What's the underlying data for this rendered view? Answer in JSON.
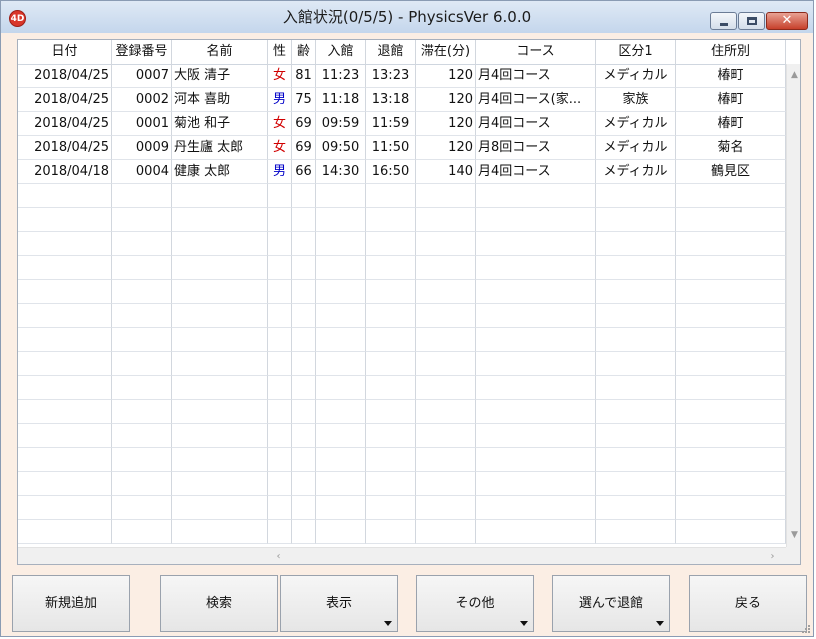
{
  "window": {
    "title": "入館状況(0/5/5) - PhysicsVer 6.0.0",
    "app_icon_text": "4D",
    "close_glyph": "✕"
  },
  "table": {
    "columns": [
      "日付",
      "登録番号",
      "名前",
      "性",
      "齢",
      "入館",
      "退館",
      "滞在(分)",
      "コース",
      "区分1",
      "住所別"
    ],
    "rows": [
      {
        "date": "2018/04/25",
        "id": "0007",
        "name": "大阪  清子",
        "sex": "女",
        "age": "81",
        "in": "11:23",
        "out": "13:23",
        "stay": "120",
        "course": "月4回コース",
        "cat": "メディカル",
        "area": "椿町"
      },
      {
        "date": "2018/04/25",
        "id": "0002",
        "name": "河本  喜助",
        "sex": "男",
        "age": "75",
        "in": "11:18",
        "out": "13:18",
        "stay": "120",
        "course": "月4回コース(家...",
        "cat": "家族",
        "area": "椿町"
      },
      {
        "date": "2018/04/25",
        "id": "0001",
        "name": "菊池  和子",
        "sex": "女",
        "age": "69",
        "in": "09:59",
        "out": "11:59",
        "stay": "120",
        "course": "月4回コース",
        "cat": "メディカル",
        "area": "椿町"
      },
      {
        "date": "2018/04/25",
        "id": "0009",
        "name": "丹生廬  太郎",
        "sex": "女",
        "age": "69",
        "in": "09:50",
        "out": "11:50",
        "stay": "120",
        "course": "月8回コース",
        "cat": "メディカル",
        "area": "菊名"
      },
      {
        "date": "2018/04/18",
        "id": "0004",
        "name": "健康  太郎",
        "sex": "男",
        "age": "66",
        "in": "14:30",
        "out": "16:50",
        "stay": "140",
        "course": "月4回コース",
        "cat": "メディカル",
        "area": "鶴見区"
      }
    ],
    "colors": {
      "female": "#d10000",
      "male": "#0000c8"
    }
  },
  "scrollbar": {
    "up": "▲",
    "down": "▼",
    "left": "‹",
    "right": "›"
  },
  "footer": {
    "add_label": "新規追加",
    "search_label": "検索",
    "display_label": "表示",
    "other_label": "その他",
    "checkout_label": "選んで退館",
    "back_label": "戻る"
  }
}
